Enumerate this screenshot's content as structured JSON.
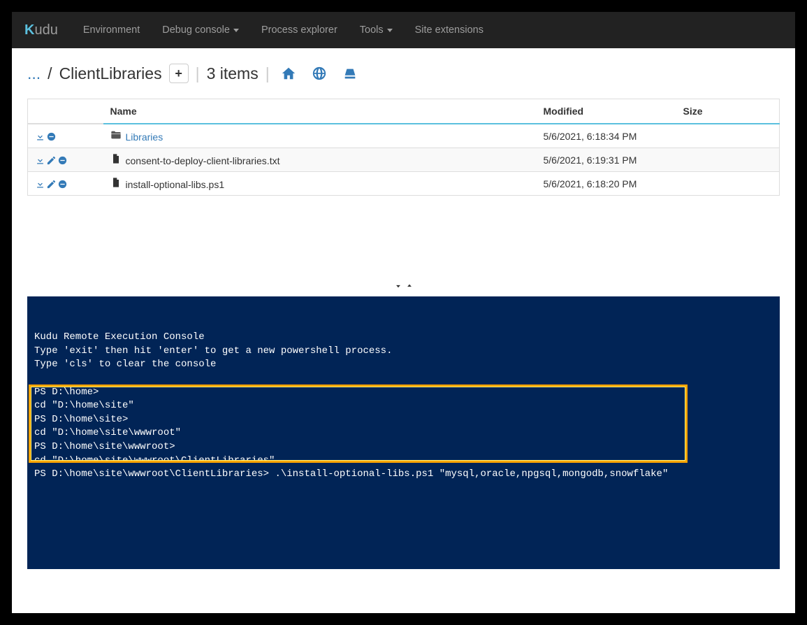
{
  "brand_prefix": "K",
  "brand_rest": "udu",
  "nav": {
    "environment": "Environment",
    "debug_console": "Debug console",
    "process_explorer": "Process explorer",
    "tools": "Tools",
    "site_extensions": "Site extensions"
  },
  "breadcrumb": {
    "ellipsis": "...",
    "sep1": "/",
    "current": "ClientLibraries",
    "add": "+",
    "div": "|",
    "items": "3 items",
    "div2": "|"
  },
  "table": {
    "headers": {
      "name": "Name",
      "modified": "Modified",
      "size": "Size"
    },
    "rows": [
      {
        "type": "folder",
        "name": "Libraries",
        "modified": "5/6/2021, 6:18:34 PM",
        "size": ""
      },
      {
        "type": "file",
        "name": "consent-to-deploy-client-libraries.txt",
        "modified": "5/6/2021, 6:19:31 PM",
        "size": ""
      },
      {
        "type": "file",
        "name": "install-optional-libs.ps1",
        "modified": "5/6/2021, 6:18:20 PM",
        "size": ""
      }
    ]
  },
  "chevrons": "❯❮",
  "console_lines": [
    "Kudu Remote Execution Console",
    "Type 'exit' then hit 'enter' to get a new powershell process.",
    "Type 'cls' to clear the console",
    "",
    "PS D:\\home>",
    "cd \"D:\\home\\site\"",
    "PS D:\\home\\site>",
    "cd \"D:\\home\\site\\wwwroot\"",
    "PS D:\\home\\site\\wwwroot>",
    "cd \"D:\\home\\site\\wwwroot\\ClientLibraries\"",
    "PS D:\\home\\site\\wwwroot\\ClientLibraries> .\\install-optional-libs.ps1 \"mysql,oracle,npgsql,mongodb,snowflake\""
  ]
}
